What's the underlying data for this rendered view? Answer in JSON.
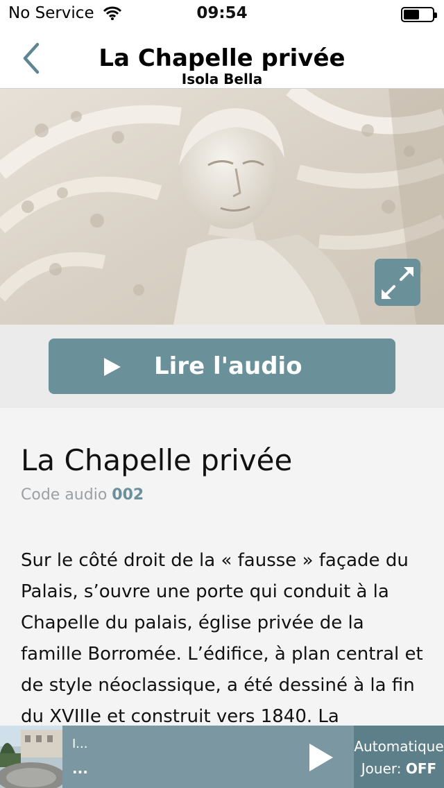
{
  "status_bar": {
    "carrier": "No Service",
    "time": "09:54",
    "wifi_icon": "wifi-icon",
    "battery_icon": "battery-icon"
  },
  "nav": {
    "title": "La Chapelle privée",
    "subtitle": "Isola Bella",
    "back_icon": "chevron-left-icon"
  },
  "hero": {
    "expand_icon": "expand-icon"
  },
  "audio": {
    "button_label": "Lire l'audio",
    "play_icon": "play-icon"
  },
  "content": {
    "title": "La Chapelle privée",
    "code_label": "Code audio",
    "code_value": "002",
    "body": "Sur le côté droit de la « fausse » façade du Palais, s’ouvre une porte qui conduit à la Chapelle du palais, église privée de la famille Borromée. L’édifice, à plan central et de style néoclassique, a été dessiné à la fin du XVIIIe et construit vers 1840. La"
  },
  "player": {
    "track_line1": "I...",
    "track_line2": "...",
    "play_icon": "play-icon",
    "auto_label": "Automatique",
    "jouer_label": "Jouer:",
    "jouer_state": "OFF"
  },
  "colors": {
    "accent": "#6a909a",
    "player_bg": "#7b98a2",
    "player_auto_bg": "#5d7f89"
  }
}
